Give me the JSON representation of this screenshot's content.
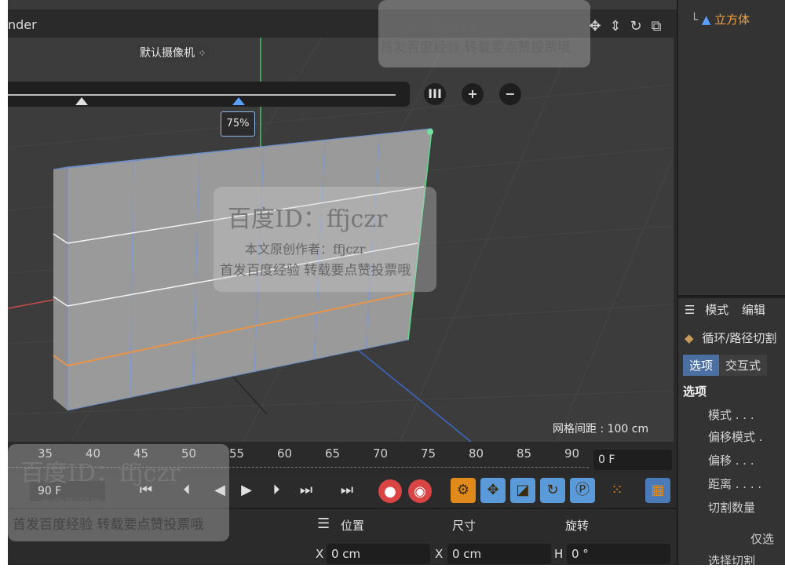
{
  "window": {
    "title_partial": "nder"
  },
  "viewport": {
    "camera_label": "默认摄像机",
    "slider_percent_label": "75%",
    "grid_spacing_label": "网格间距 : 100 cm",
    "buttons": {
      "pause": "III",
      "plus": "+",
      "minus": "−"
    }
  },
  "object_manager": {
    "object_name": "立方体"
  },
  "attributes": {
    "menu": [
      "模式",
      "编辑"
    ],
    "tool_name": "循环/路径切割",
    "tabs": [
      "选项",
      "交互式"
    ],
    "section_title": "选项",
    "fields": [
      "模式 . . .",
      "偏移模式 .",
      "偏移 . . .",
      "距离 . . . .",
      "切割数量"
    ],
    "bottom": [
      "仅选",
      "选择切割"
    ]
  },
  "timeline": {
    "ticks": [
      "35",
      "40",
      "45",
      "50",
      "55",
      "60",
      "65",
      "70",
      "75",
      "80",
      "85",
      "90"
    ],
    "current_frame": "0 F"
  },
  "transport": {
    "end_frame": "90 F"
  },
  "coordinates": {
    "headers": {
      "position": "位置",
      "size": "尺寸",
      "rotation": "旋转"
    },
    "pos_x": {
      "label": "X",
      "value": "0 cm"
    },
    "size_x": {
      "label": "X",
      "value": "0 cm"
    },
    "rot_h": {
      "label": "H",
      "value": "0 °"
    }
  },
  "watermark": {
    "line1": "百度ID：ffjczr",
    "line2": "本文原创作者：ffjczr",
    "line3": "首发百度经验  转载要点赞投票哦"
  },
  "colors": {
    "accent_orange": "#f0a040",
    "active_tab": "#4a6fa0",
    "record_red": "#d94444"
  }
}
